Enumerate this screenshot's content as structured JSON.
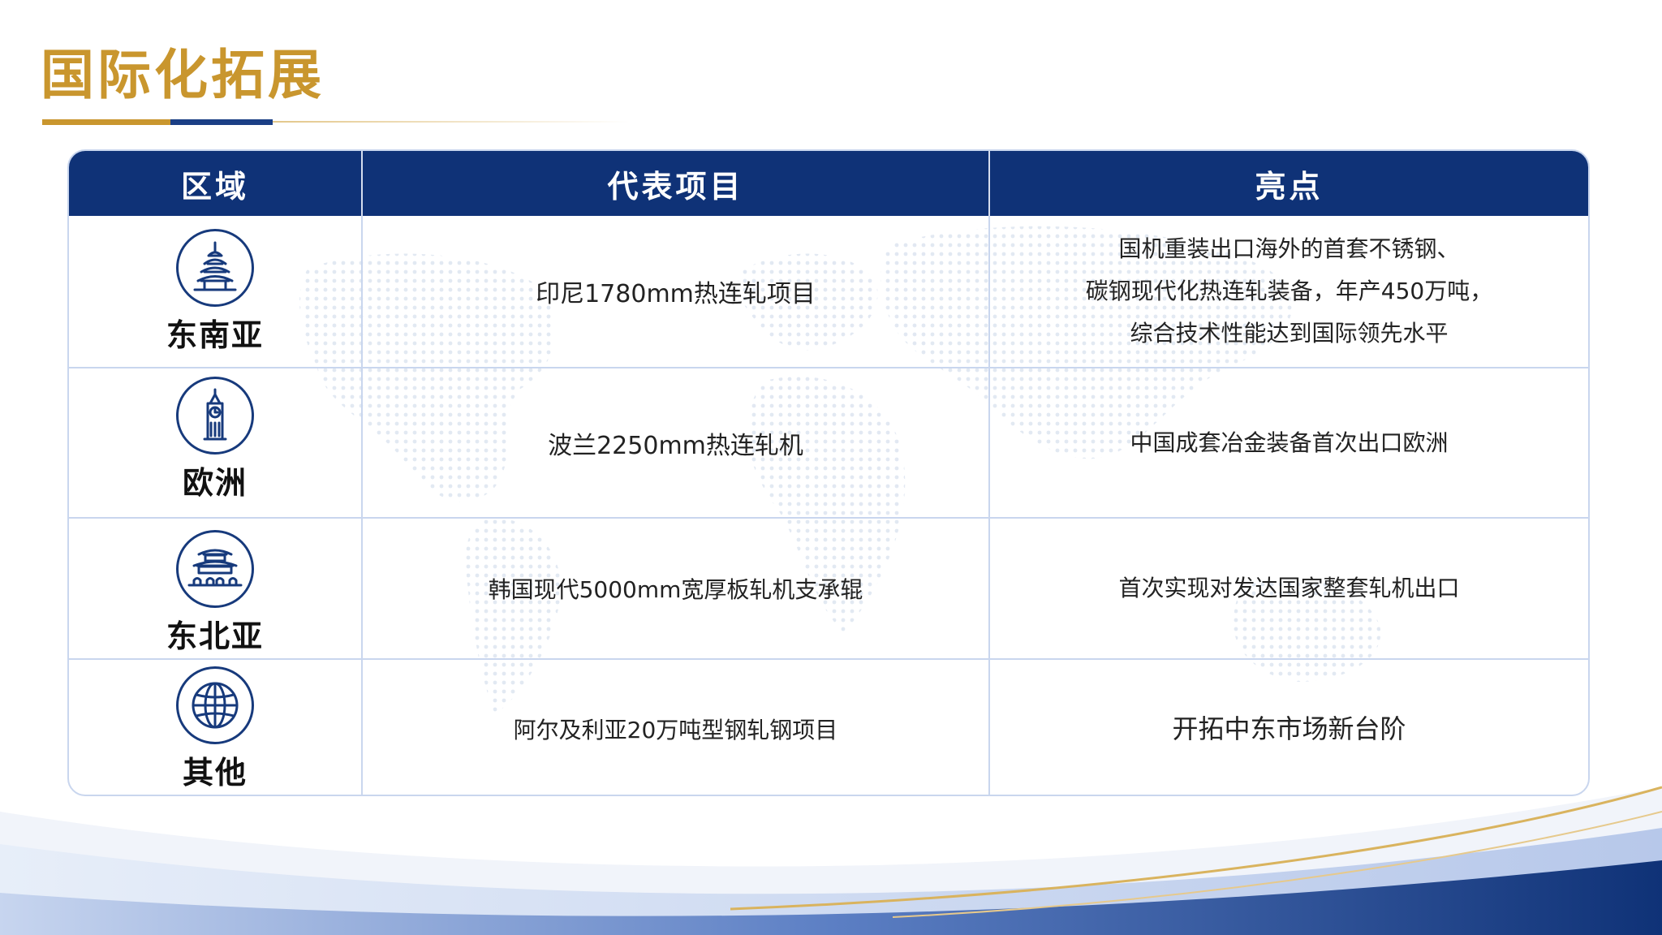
{
  "title": "国际化拓展",
  "colors": {
    "gold": "#c9962e",
    "navy": "#0f3277",
    "accent_blue": "#1b3f85"
  },
  "table": {
    "headers": [
      "区域",
      "代表项目",
      "亮点"
    ],
    "rows": [
      {
        "region": "东南亚",
        "icon": "pagoda-icon",
        "project": "印尼1780mm热连轧项目",
        "highlight_lines": [
          "国机重装出口海外的首套不锈钢、",
          "碳钢现代化热连轧装备，年产450万吨，",
          "综合技术性能达到国际领先水平"
        ]
      },
      {
        "region": "欧洲",
        "icon": "clock-tower-icon",
        "project": "波兰2250mm热连轧机",
        "highlight_lines": [
          "中国成套冶金装备首次出口欧洲"
        ]
      },
      {
        "region": "东北亚",
        "icon": "palace-gate-icon",
        "project": "韩国现代5000mm宽厚板轧机支承辊",
        "highlight_lines": [
          "首次实现对发达国家整套轧机出口"
        ]
      },
      {
        "region": "其他",
        "icon": "globe-icon",
        "project": "阿尔及利亚20万吨型钢轧钢项目",
        "highlight_lines": [
          "开拓中东市场新台阶"
        ]
      }
    ]
  }
}
